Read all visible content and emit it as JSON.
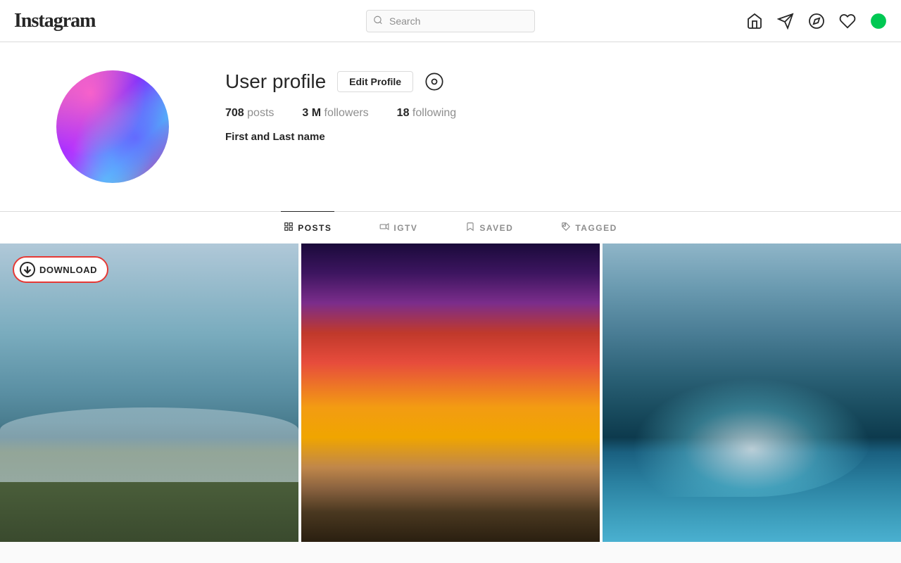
{
  "header": {
    "logo": "Instagram",
    "search_placeholder": "Search",
    "nav_icons": [
      "home",
      "send",
      "explore",
      "heart",
      "download"
    ]
  },
  "profile": {
    "username": "User profile",
    "edit_button": "Edit Profile",
    "stats": {
      "posts_count": "708",
      "posts_label": "posts",
      "followers_count": "3 M",
      "followers_label": "followers",
      "following_count": "18",
      "following_label": "following"
    },
    "full_name": "First and Last name"
  },
  "tabs": [
    {
      "id": "posts",
      "label": "POSTS",
      "icon": "grid"
    },
    {
      "id": "igtv",
      "label": "IGTV",
      "icon": "igtv"
    },
    {
      "id": "saved",
      "label": "SAVED",
      "icon": "bookmark"
    },
    {
      "id": "tagged",
      "label": "TAGGED",
      "icon": "tag"
    }
  ],
  "download_button": {
    "label": "DOWNLOAD",
    "icon": "download-circle"
  }
}
